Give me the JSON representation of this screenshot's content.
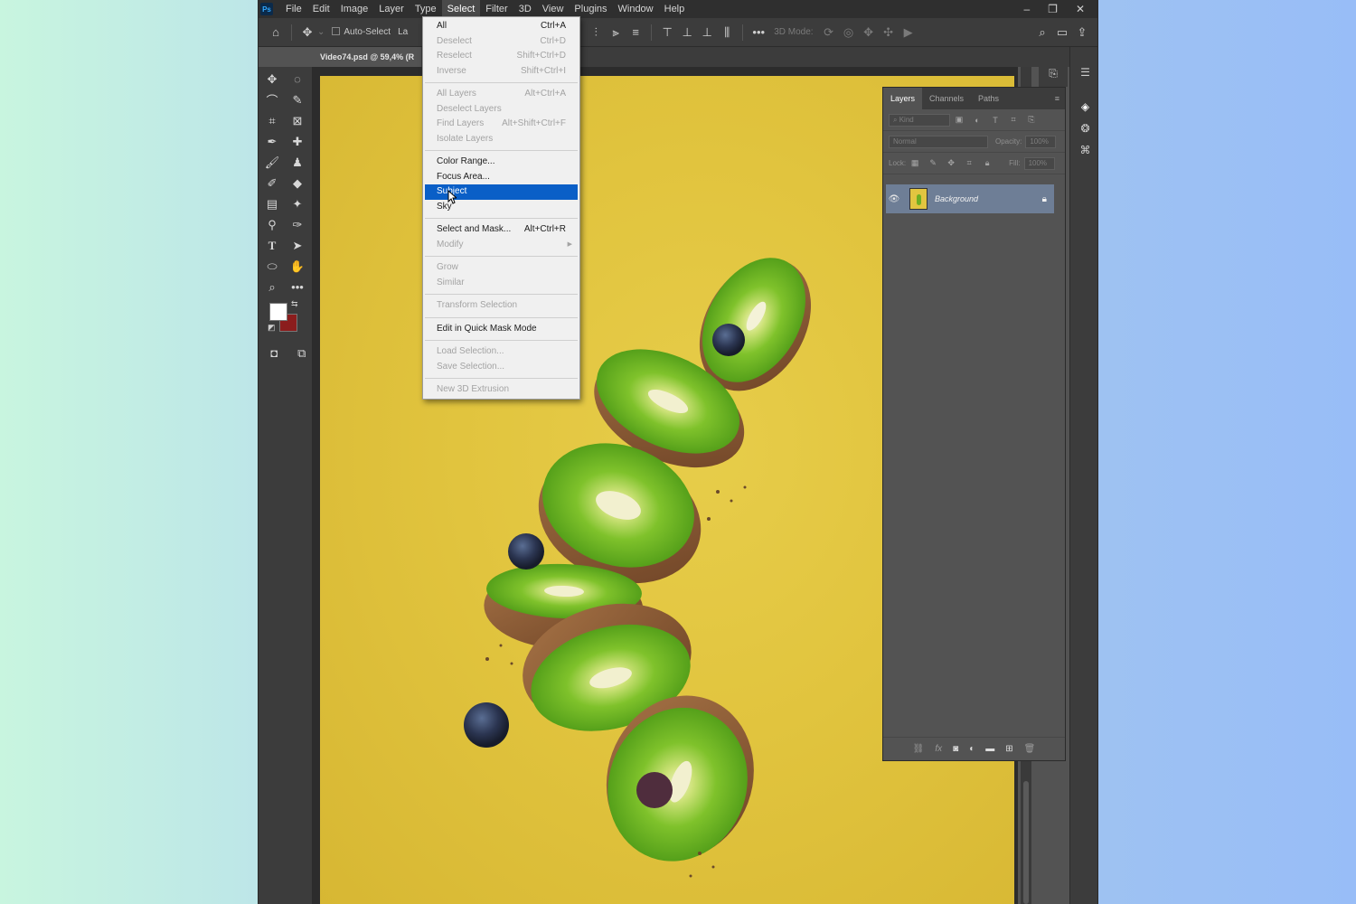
{
  "app": {
    "logo_text": "Ps",
    "document_tab": "Video74.psd @ 59,4% (R"
  },
  "menubar": {
    "items": [
      "File",
      "Edit",
      "Image",
      "Layer",
      "Type",
      "Select",
      "Filter",
      "3D",
      "View",
      "Plugins",
      "Window",
      "Help"
    ],
    "active": "Select"
  },
  "options_bar": {
    "auto_select_label": "Auto-Select",
    "layer_dropdown_prefix": "La",
    "mode_label": "3D Mode:"
  },
  "select_menu": {
    "groups": [
      [
        {
          "label": "All",
          "shortcut": "Ctrl+A",
          "disabled": false
        },
        {
          "label": "Deselect",
          "shortcut": "Ctrl+D",
          "disabled": true
        },
        {
          "label": "Reselect",
          "shortcut": "Shift+Ctrl+D",
          "disabled": true
        },
        {
          "label": "Inverse",
          "shortcut": "Shift+Ctrl+I",
          "disabled": true
        }
      ],
      [
        {
          "label": "All Layers",
          "shortcut": "Alt+Ctrl+A",
          "disabled": true
        },
        {
          "label": "Deselect Layers",
          "shortcut": "",
          "disabled": true
        },
        {
          "label": "Find Layers",
          "shortcut": "Alt+Shift+Ctrl+F",
          "disabled": true
        },
        {
          "label": "Isolate Layers",
          "shortcut": "",
          "disabled": true
        }
      ],
      [
        {
          "label": "Color Range...",
          "shortcut": "",
          "disabled": false
        },
        {
          "label": "Focus Area...",
          "shortcut": "",
          "disabled": false
        },
        {
          "label": "Subject",
          "shortcut": "",
          "disabled": false,
          "highlight": true
        },
        {
          "label": "Sky",
          "shortcut": "",
          "disabled": false
        }
      ],
      [
        {
          "label": "Select and Mask...",
          "shortcut": "Alt+Ctrl+R",
          "disabled": false
        },
        {
          "label": "Modify",
          "shortcut": "",
          "disabled": true,
          "submenu": true
        }
      ],
      [
        {
          "label": "Grow",
          "shortcut": "",
          "disabled": true
        },
        {
          "label": "Similar",
          "shortcut": "",
          "disabled": true
        }
      ],
      [
        {
          "label": "Transform Selection",
          "shortcut": "",
          "disabled": true
        }
      ],
      [
        {
          "label": "Edit in Quick Mask Mode",
          "shortcut": "",
          "disabled": false
        }
      ],
      [
        {
          "label": "Load Selection...",
          "shortcut": "",
          "disabled": true
        },
        {
          "label": "Save Selection...",
          "shortcut": "",
          "disabled": true
        }
      ],
      [
        {
          "label": "New 3D Extrusion",
          "shortcut": "",
          "disabled": true
        }
      ]
    ]
  },
  "layers_panel": {
    "tabs": [
      "Layers",
      "Channels",
      "Paths"
    ],
    "active_tab": "Layers",
    "search_placeholder": "Kind",
    "blend_mode": "Normal",
    "opacity_label": "Opacity:",
    "opacity_value": "100%",
    "lock_label": "Lock:",
    "fill_label": "Fill:",
    "fill_value": "100%",
    "layers": [
      {
        "name": "Background",
        "visible": true,
        "locked": true
      }
    ]
  },
  "colors": {
    "foreground": "#ffffff",
    "background": "#8b1d1d",
    "highlight": "#0a5fc7",
    "canvas_yellow": "#e1c43e"
  }
}
